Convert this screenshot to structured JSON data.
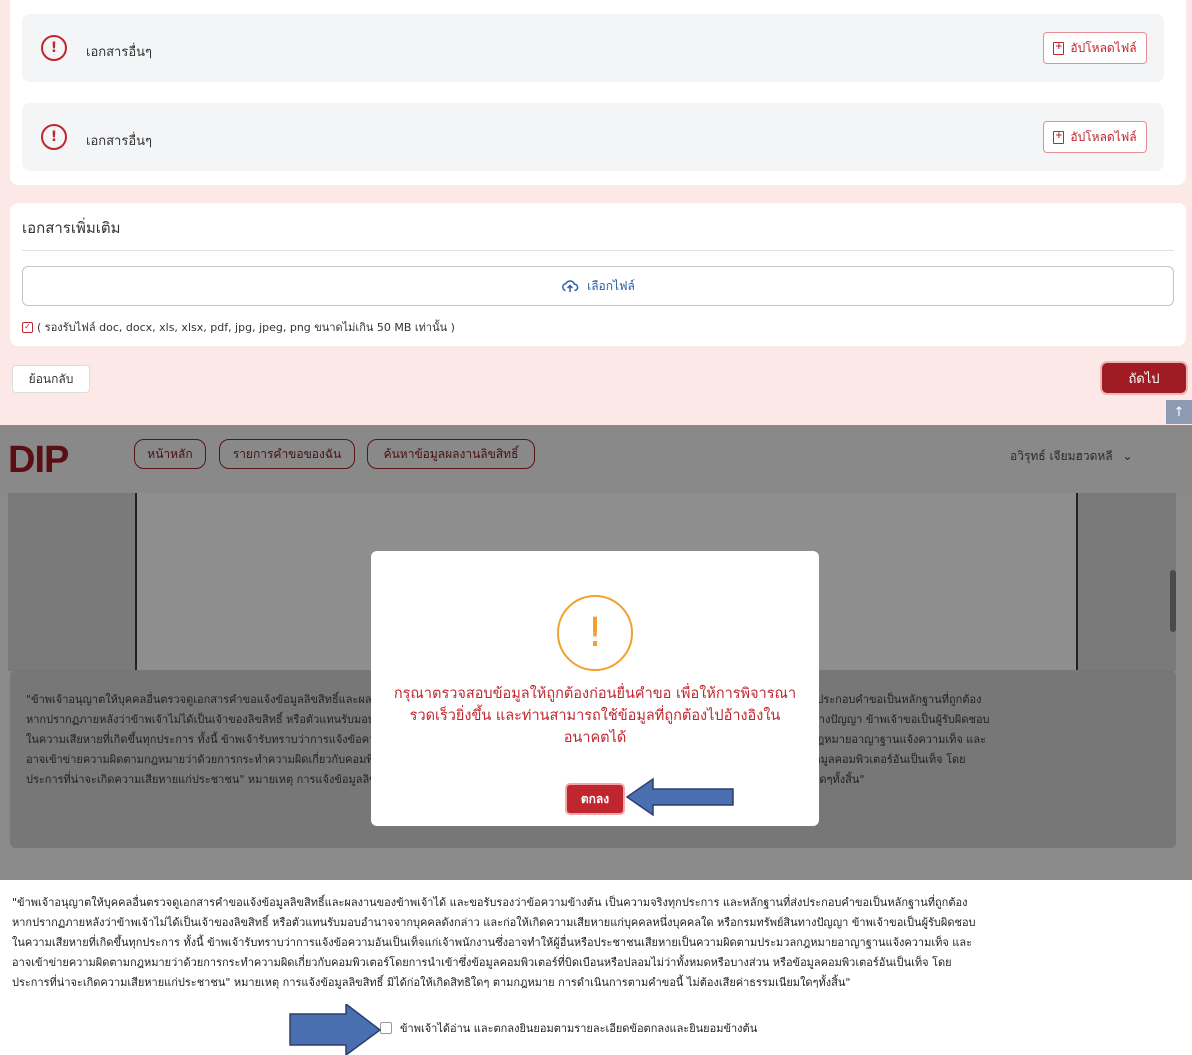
{
  "upload_docs": {
    "rows": [
      {
        "label": "เอกสารอื่นๆ",
        "button": "อัปโหลดไฟล์"
      },
      {
        "label": "เอกสารอื่นๆ",
        "button": "อัปโหลดไฟล์"
      }
    ]
  },
  "extra_docs": {
    "title": "เอกสารเพิ่มเติม",
    "pick_label": "เลือกไฟล์",
    "note": "( รองรับไฟล์ doc, docx, xls, xlsx, pdf, jpg, jpeg, png ขนาดไม่เกิน 50 MB เท่านั้น )"
  },
  "footer_nav": {
    "back": "ย้อนกลับ",
    "next": "ถัดไป"
  },
  "header": {
    "logo": "DIP",
    "nav": [
      "หน้าหลัก",
      "รายการคำขอของฉัน",
      "ค้นหาข้อมูลผลงานลิขสิทธิ์"
    ],
    "user": "อวิรุทธ์ เจียมฮวดหลี"
  },
  "modal": {
    "message": "กรุณาตรวจสอบข้อมูลให้ถูกต้องก่อนยื่นคำขอ เพื่อให้การพิจารณารวดเร็วยิ่งขึ้น และท่านสามารถใช้ข้อมูลที่ถูกต้องไปอ้างอิงในอนาคตได้",
    "ok": "ตกลง"
  },
  "consent": {
    "lines": [
      "\"ข้าพเจ้าอนุญาตให้บุคคลอื่นตรวจดูเอกสารคำขอแจ้งข้อมูลลิขสิทธิ์และผลงานของข้าพเจ้าได้ และขอรับรองว่าข้อความข้างต้น เป็นความจริงทุกประการ และหลักฐานที่ส่งประกอบคำขอเป็นหลักฐานที่ถูกต้อง",
      "หากปรากฏภายหลังว่าข้าพเจ้าไม่ได้เป็นเจ้าของลิขสิทธิ์ หรือตัวแทนรับมอบอำนาจจากบุคคลดังกล่าว และก่อให้เกิดความเสียหายแก่บุคคลหนึ่งบุคคลใด หรือกรมทรัพย์สินทางปัญญา ข้าพเจ้าขอเป็นผู้รับผิดชอบ",
      "ในความเสียหายที่เกิดขึ้นทุกประการ ทั้งนี้ ข้าพเจ้ารับทราบว่าการแจ้งข้อความอันเป็นเท็จแก่เจ้าพนักงานซึ่งอาจทำให้ผู้อื่นหรือประชาชนเสียหายเป็นความผิดตามประมวลกฎหมายอาญาฐานแจ้งความเท็จ และ",
      "อาจเข้าข่ายความผิดตามกฎหมายว่าด้วยการกระทำความผิดเกี่ยวกับคอมพิวเตอร์โดยการนำเข้าซึ่งข้อมูลคอมพิวเตอร์ที่บิดเบือนหรือปลอมไม่ว่าทั้งหมดหรือบางส่วน หรือข้อมูลคอมพิวเตอร์อันเป็นเท็จ โดย",
      "ประการที่น่าจะเกิดความเสียหายแก่ประชาชน\" หมายเหตุ การแจ้งข้อมูลลิขสิทธิ์ มิได้ก่อให้เกิดสิทธิใดๆ ตามกฎหมาย การดำเนินการตามคำขอนี้ ไม่ต้องเสียค่าธรรมเนียมใดๆทั้งสิ้น\""
    ],
    "agree_label": "ข้าพเจ้าได้อ่าน และตกลงยินยอมตามรายละเอียดข้อตกลงและยินยอมข้างต้น"
  },
  "colors": {
    "brand_red": "#c0262d",
    "next_button": "#a01c24",
    "warning": "#f0a12e",
    "arrow": "#4a6fb0"
  },
  "icons": [
    "alert-circle-icon",
    "file-upload-icon",
    "cloud-upload-icon",
    "check-square-icon",
    "arrow-up-icon",
    "chevron-down-icon",
    "warning-icon",
    "pointer-arrow-icon"
  ]
}
